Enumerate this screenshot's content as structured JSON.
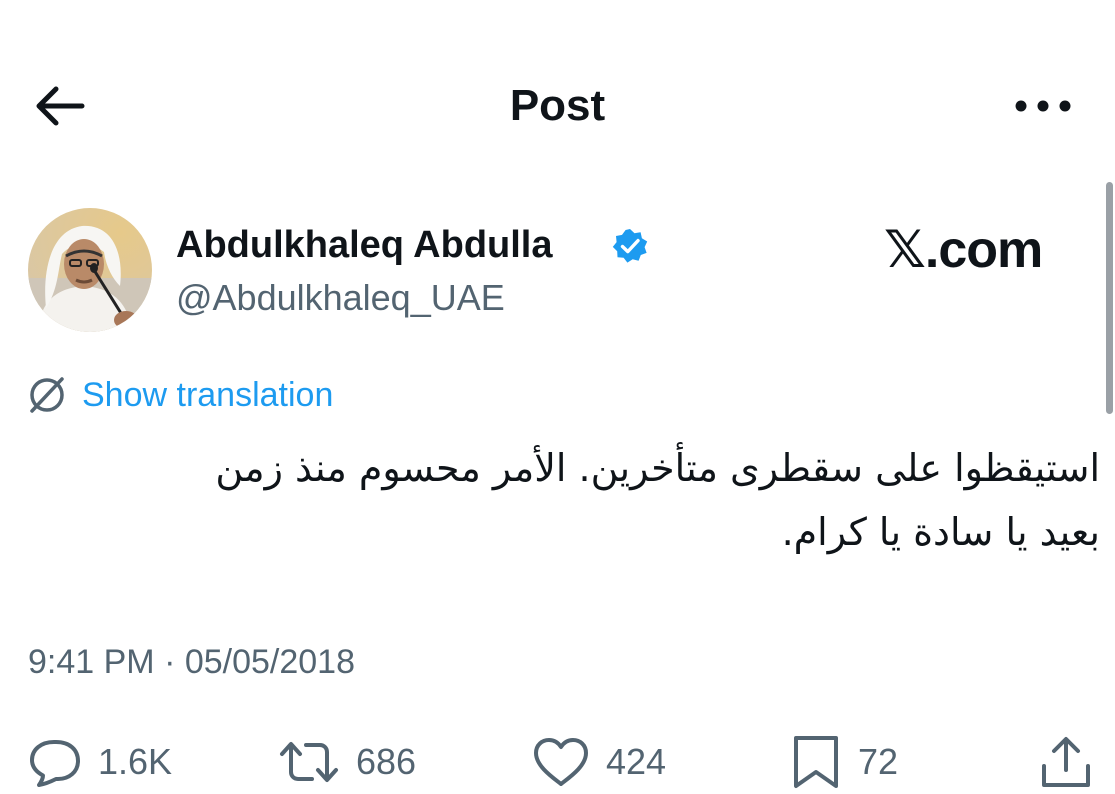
{
  "header": {
    "title": "Post",
    "back_icon": "arrow-left-icon",
    "more_icon": "more-horizontal-icon"
  },
  "author": {
    "name": "Abdulkhaleq Abdulla",
    "handle": "@Abdulkhaleq_UAE",
    "verified": true,
    "verified_color": "#1d9bf0"
  },
  "brand": {
    "logo_text": "𝕏.com"
  },
  "translation": {
    "link_label": "Show translation",
    "icon": "globe-translate-icon"
  },
  "tweet": {
    "text_lines": [
      "استيقظوا على سقطرى متأخرين. الأمر محسوم منذ زمن",
      "بعيد يا سادة يا كرام."
    ],
    "timestamp": "9:41 PM · 05/05/2018"
  },
  "actions": {
    "replies": "1.6K",
    "reposts": "686",
    "likes": "424",
    "bookmarks": "72"
  },
  "colors": {
    "text": "#0f1419",
    "secondary": "#536471",
    "accent": "#1d9bf0"
  }
}
